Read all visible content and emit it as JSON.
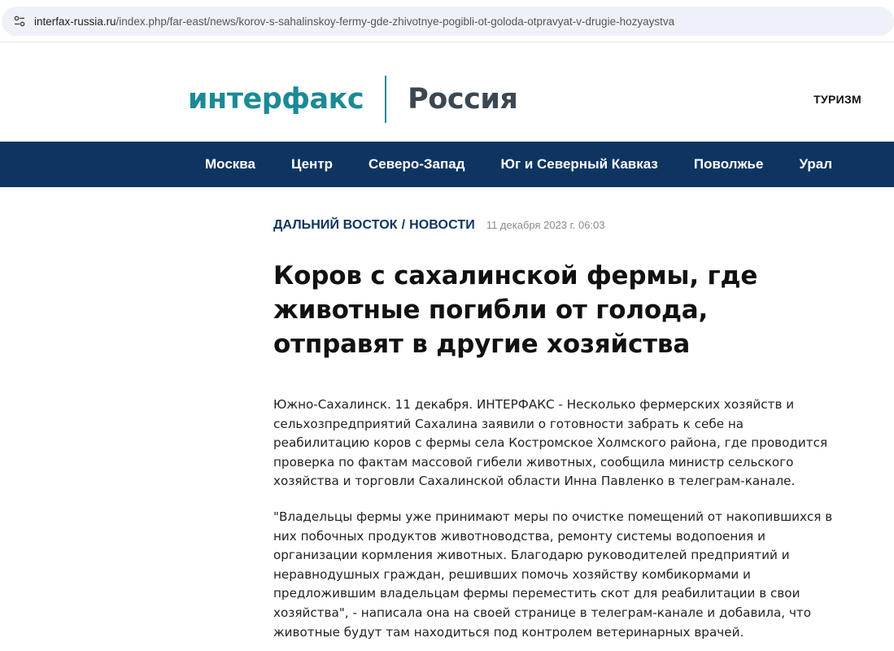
{
  "browser": {
    "url_host": "interfax-russia.ru",
    "url_path": "/index.php/far-east/news/korov-s-sahalinskoy-fermy-gde-zhivotnye-pogibli-ot-goloda-otpravyat-v-drugie-hozyaystva"
  },
  "header": {
    "logo_text": "интерфакс",
    "region_text": "Россия",
    "top_link": "ТУРИЗМ",
    "brand_color": "#1b8a96"
  },
  "nav": {
    "items": [
      "Москва",
      "Центр",
      "Северо-Запад",
      "Юг и Северный Кавказ",
      "Поволжье",
      "Урал"
    ],
    "bg_color": "#0e3562"
  },
  "article": {
    "category": "ДАЛЬНИЙ ВОСТОК",
    "separator": "/",
    "section": "НОВОСТИ",
    "date": "11 декабря 2023 г. 06:03",
    "title": "Коров с сахалинской фермы, где животные погибли от голода, отправят в другие хозяйства",
    "paragraphs": [
      "Южно-Сахалинск. 11 декабря. ИНТЕРФАКС - Несколько фермерских хозяйств и сельхозпредприятий Сахалина заявили о готовности забрать к себе на реабилитацию коров с фермы села Костромское Холмского района, где проводится проверка по фактам массовой гибели животных, сообщила министр сельского хозяйства и торговли Сахалинской области Инна Павленко в телеграм-канале.",
      "\"Владельцы фермы уже принимают меры по очистке помещений от накопившихся в них побочных продуктов животноводства, ремонту системы водопоения и организации кормления животных. Благодарю руководителей предприятий и неравнодушных граждан, решивших помочь хозяйству комбикормами и предложившим владельцам фермы переместить скот для реабилитации в свои хозяйства\", - написала она на своей странице в телеграм-канале и добавила, что животные будут там находиться под контролем ветеринарных врачей."
    ]
  }
}
